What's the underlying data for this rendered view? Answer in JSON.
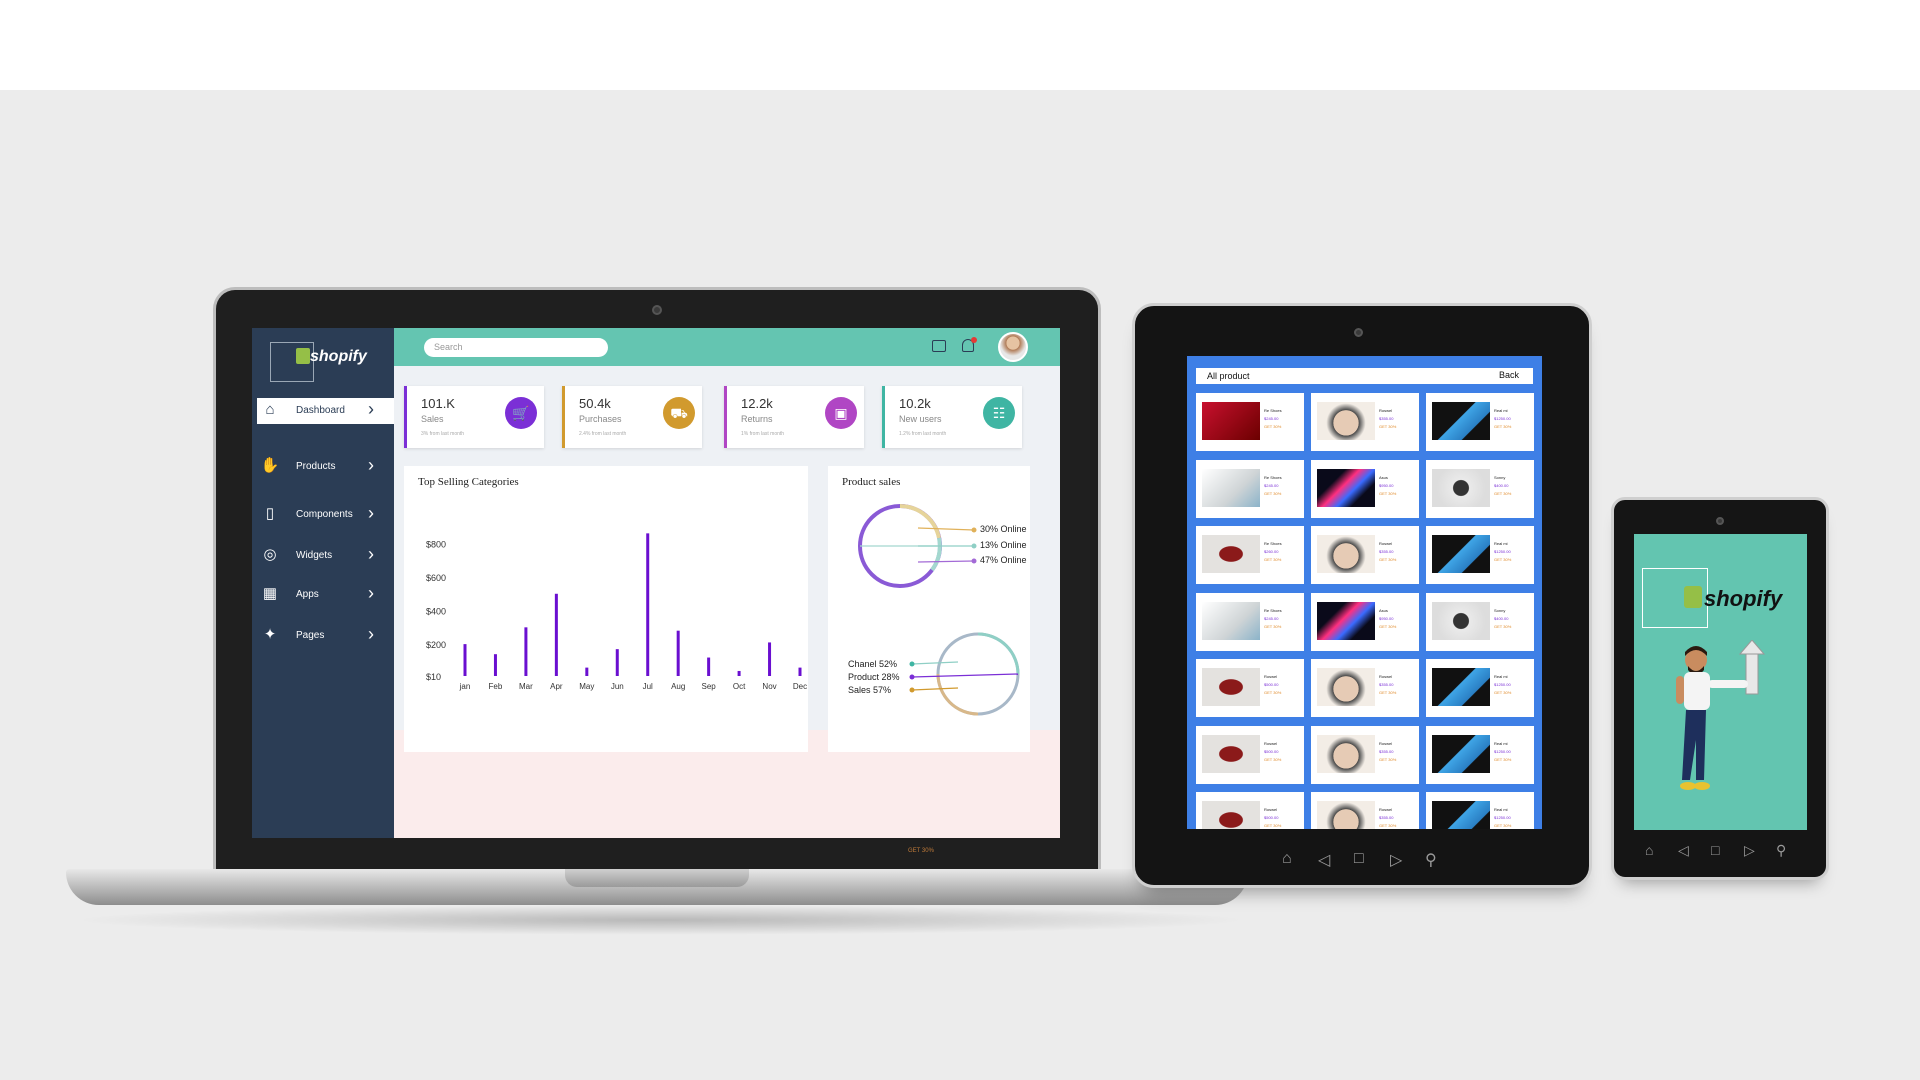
{
  "laptop": {
    "brand": "shopify",
    "search_placeholder": "Search",
    "bezel_text": "GET 30%",
    "sidebar": [
      {
        "label": "Dashboard",
        "icon": "home-icon"
      },
      {
        "label": "Products",
        "icon": "hand-drops-icon"
      },
      {
        "label": "Components",
        "icon": "remote-icon"
      },
      {
        "label": "Widgets",
        "icon": "widget-icon"
      },
      {
        "label": "Apps",
        "icon": "grid-icon"
      },
      {
        "label": "Pages",
        "icon": "star-page-icon"
      }
    ],
    "stats": [
      {
        "value": "101.K",
        "label": "Sales",
        "sub": "3% from last month",
        "color": "#7b2fd6",
        "icon": "cart-icon"
      },
      {
        "value": "50.4k",
        "label": "Purchases",
        "sub": "2.4% from last month",
        "color": "#d19a2e",
        "icon": "truck-icon"
      },
      {
        "value": "12.2k",
        "label": "Returns",
        "sub": "1% from last month",
        "color": "#b046c4",
        "icon": "bag-icon"
      },
      {
        "value": "10.2k",
        "label": "New users",
        "sub": "1.2% from last month",
        "color": "#3fb5a3",
        "icon": "contact-icon"
      }
    ],
    "bar_panel_title": "Top Selling Categories",
    "pie_panel_title": "Product sales",
    "donut1_labels": [
      "30% Online",
      "13% Online",
      "47% Online"
    ],
    "donut2_labels": [
      "Chanel 52%",
      "Product 28%",
      "Sales 57%"
    ]
  },
  "chart_data": {
    "type": "bar",
    "title": "Top Selling Categories",
    "categories": [
      "jan",
      "Feb",
      "Mar",
      "Apr",
      "May",
      "Jun",
      "Jul",
      "Aug",
      "Sep",
      "Oct",
      "Nov",
      "Dec"
    ],
    "values": [
      200,
      140,
      300,
      500,
      60,
      170,
      860,
      280,
      120,
      40,
      210,
      60
    ],
    "ytick_labels": [
      "$800",
      "$600",
      "$400",
      "$200",
      "$10"
    ],
    "ytick_values": [
      800,
      600,
      400,
      200,
      10
    ],
    "ylim": [
      10,
      880
    ],
    "color": "#6a0fd0"
  },
  "tablet": {
    "header_left": "All product",
    "header_right": "Back",
    "cards": [
      {
        "name": "Re Shoes",
        "price": "$245.00",
        "offer": "GET 30%",
        "img": "red-shoe"
      },
      {
        "name": "Roswel",
        "price": "$355.00",
        "offer": "GET 30%",
        "img": "bag"
      },
      {
        "name": "Real mi",
        "price": "$1250.00",
        "offer": "GET 30%",
        "img": "phone"
      },
      {
        "name": "Re Shoes",
        "price": "$245.00",
        "offer": "GET 30%",
        "img": "white-shoe"
      },
      {
        "name": "Asus",
        "price": "$950.00",
        "offer": "GET 30%",
        "img": "laptop"
      },
      {
        "name": "Sonny",
        "price": "$400.00",
        "offer": "GET 30%",
        "img": "headphones"
      },
      {
        "name": "Re Shoes",
        "price": "$260.00",
        "offer": "GET 30%",
        "img": "dress"
      },
      {
        "name": "Roswel",
        "price": "$355.00",
        "offer": "GET 30%",
        "img": "bag"
      },
      {
        "name": "Real mi",
        "price": "$1250.00",
        "offer": "GET 30%",
        "img": "phone"
      },
      {
        "name": "Re Shoes",
        "price": "$245.00",
        "offer": "GET 30%",
        "img": "white-shoe"
      },
      {
        "name": "Asus",
        "price": "$950.00",
        "offer": "GET 30%",
        "img": "laptop"
      },
      {
        "name": "Sonny",
        "price": "$400.00",
        "offer": "GET 30%",
        "img": "headphones"
      },
      {
        "name": "Roswel",
        "price": "$500.00",
        "offer": "GET 30%",
        "img": "dress"
      },
      {
        "name": "Roswel",
        "price": "$355.00",
        "offer": "GET 30%",
        "img": "bag"
      },
      {
        "name": "Real mi",
        "price": "$1250.00",
        "offer": "GET 30%",
        "img": "phone"
      },
      {
        "name": "Roswel",
        "price": "$500.00",
        "offer": "GET 30%",
        "img": "dress"
      },
      {
        "name": "Roswel",
        "price": "$355.00",
        "offer": "GET 30%",
        "img": "bag"
      },
      {
        "name": "Real mi",
        "price": "$1250.00",
        "offer": "GET 30%",
        "img": "phone"
      },
      {
        "name": "Roswel",
        "price": "$500.00",
        "offer": "GET 30%",
        "img": "dress"
      },
      {
        "name": "Roswel",
        "price": "$355.00",
        "offer": "GET 30%",
        "img": "bag"
      },
      {
        "name": "Real mi",
        "price": "$1250.00",
        "offer": "GET 30%",
        "img": "phone"
      }
    ]
  },
  "phone": {
    "brand": "shopify"
  }
}
